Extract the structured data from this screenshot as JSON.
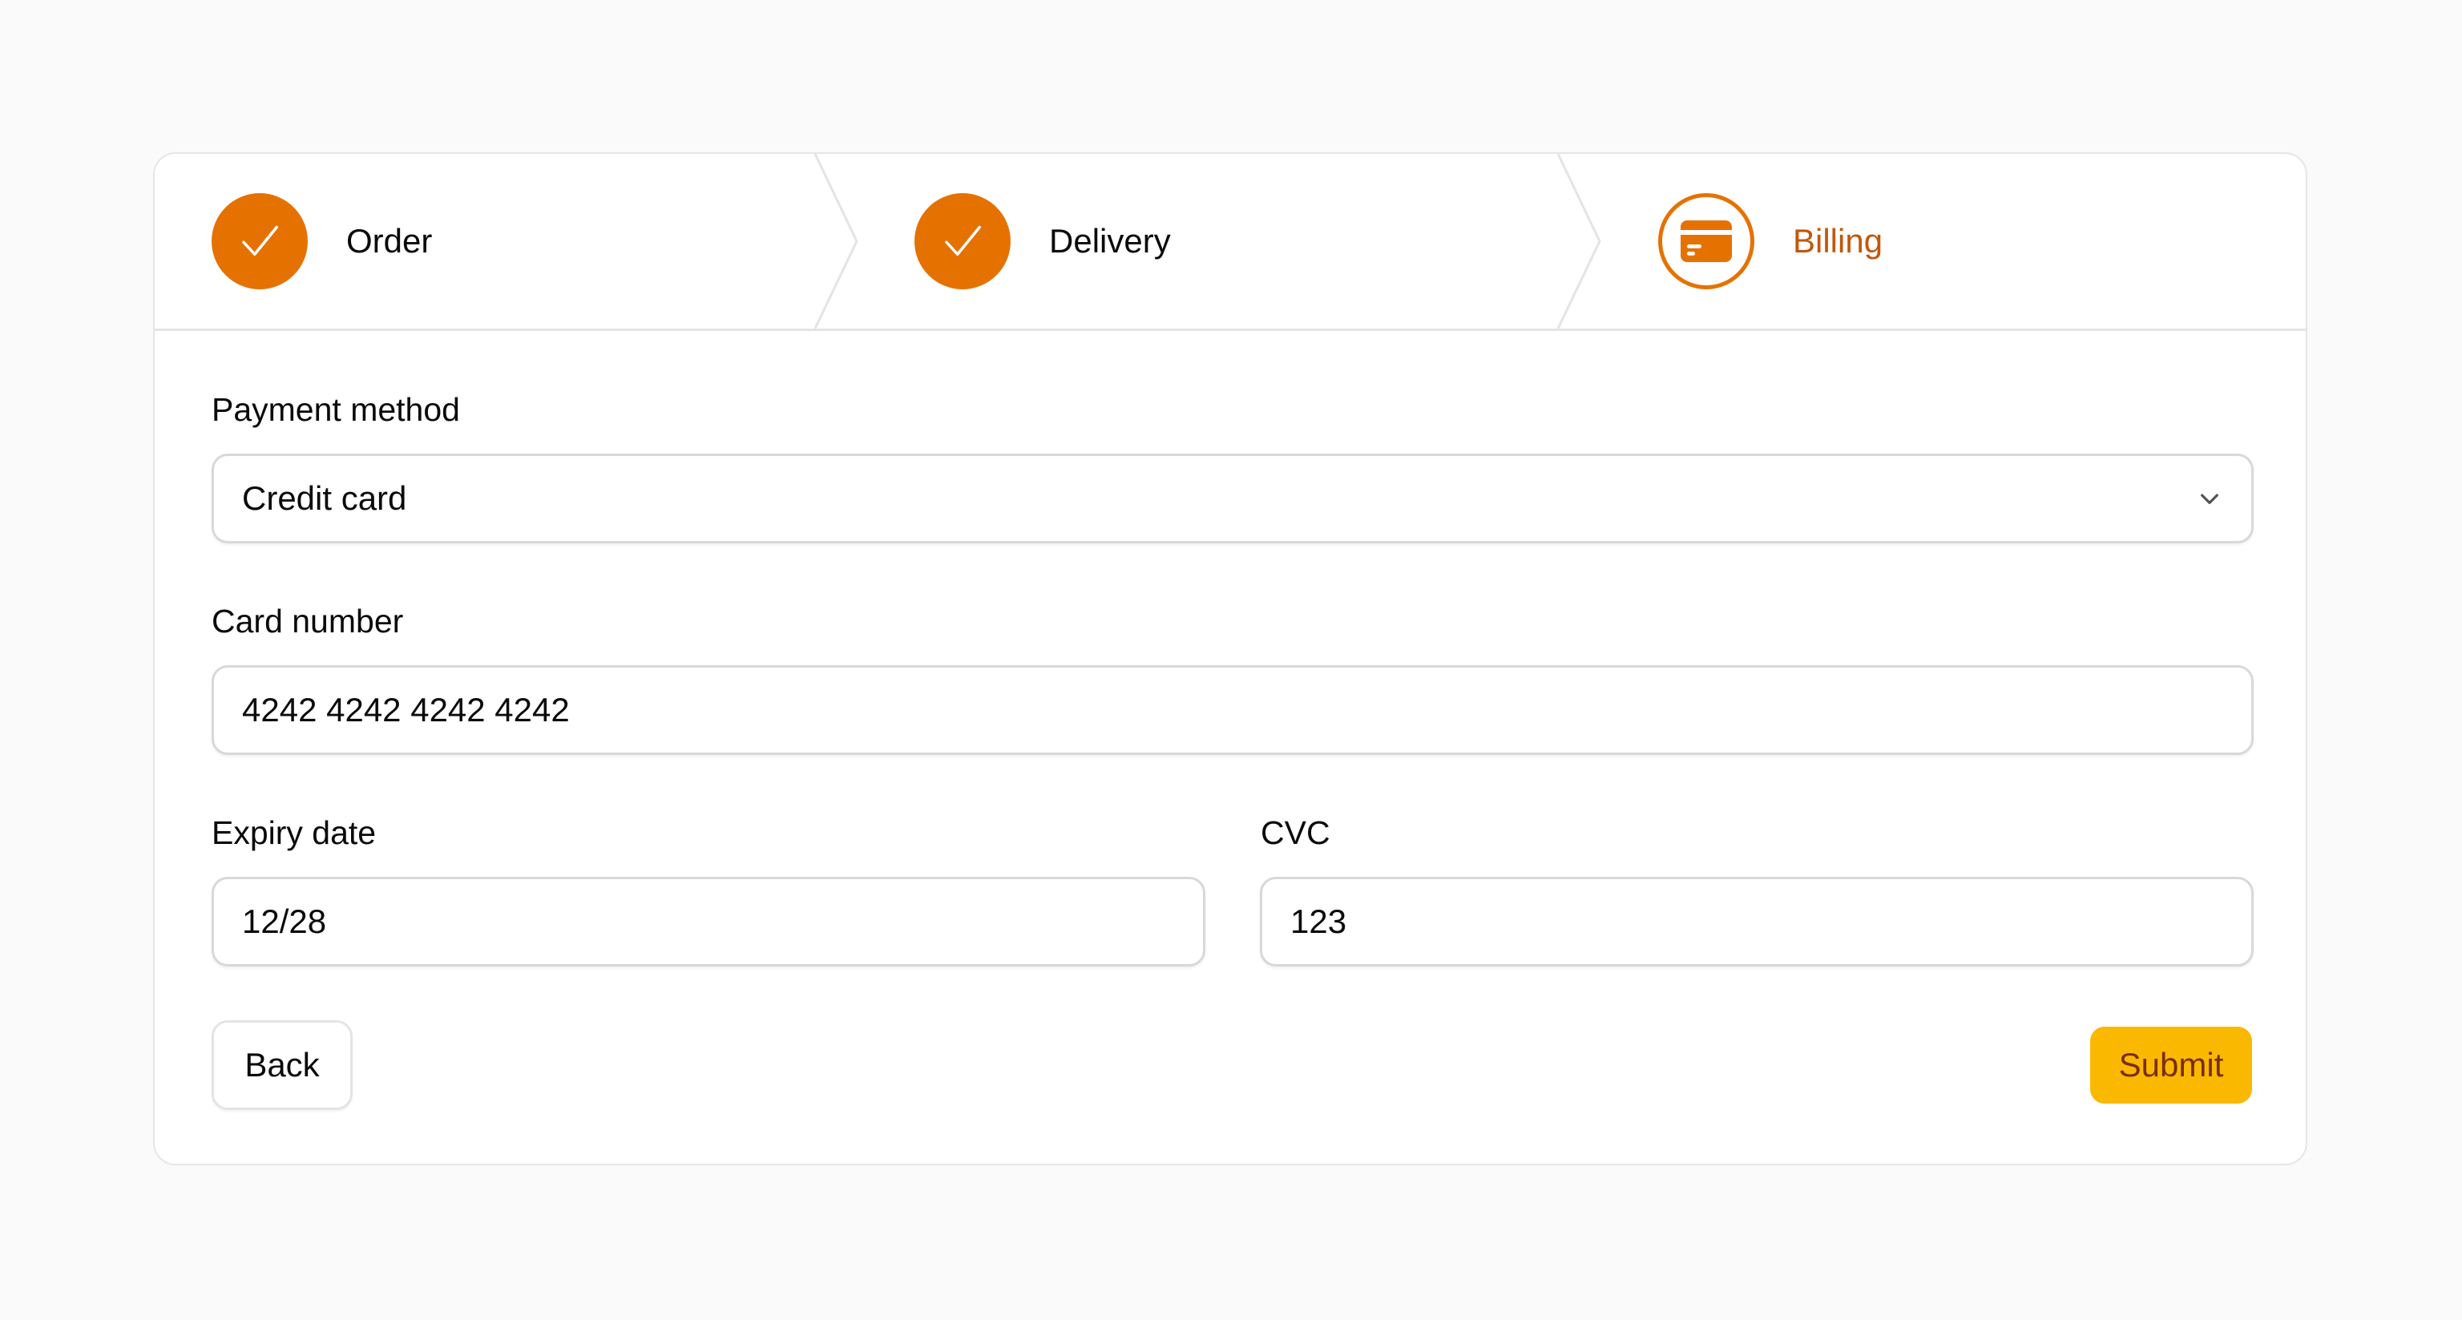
{
  "stepper": {
    "steps": [
      {
        "label": "Order",
        "status": "complete",
        "icon": "check-icon"
      },
      {
        "label": "Delivery",
        "status": "complete",
        "icon": "check-icon"
      },
      {
        "label": "Billing",
        "status": "current",
        "icon": "credit-card-icon"
      }
    ]
  },
  "form": {
    "payment_method": {
      "label": "Payment method",
      "value": "Credit card",
      "icon": "chevron-down-icon"
    },
    "card_number": {
      "label": "Card number",
      "value": "4242 4242 4242 4242"
    },
    "expiry_date": {
      "label": "Expiry date",
      "value": "12/28"
    },
    "cvc": {
      "label": "CVC",
      "value": "123"
    }
  },
  "actions": {
    "back_label": "Back",
    "submit_label": "Submit"
  },
  "colors": {
    "accent": "#e57200",
    "active_label": "#c2570c",
    "submit_bg": "#fbb800",
    "submit_text": "#7a2e0e",
    "page_bg": "#fafafa"
  }
}
